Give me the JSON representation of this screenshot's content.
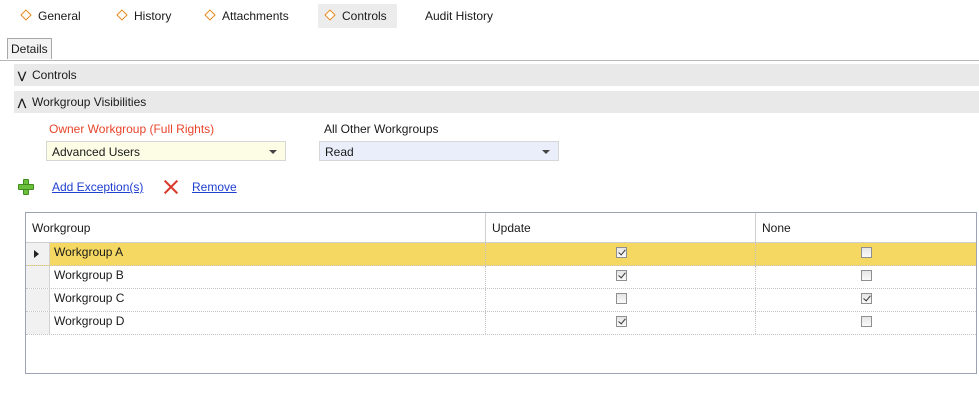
{
  "tabs": [
    {
      "label": "General",
      "icon": "diamond-icon"
    },
    {
      "label": "History",
      "icon": "diamond-icon"
    },
    {
      "label": "Attachments",
      "icon": "diamond-icon"
    },
    {
      "label": "Controls",
      "icon": "diamond-icon",
      "active": true
    },
    {
      "label": "Audit History"
    }
  ],
  "subtab": {
    "label": "Details"
  },
  "sections": {
    "controls": {
      "label": "Controls",
      "state": "collapsed"
    },
    "workgroup_visibilities": {
      "label": "Workgroup Visibilities",
      "state": "expanded"
    }
  },
  "owner": {
    "label": "Owner Workgroup (Full Rights)",
    "value": "Advanced Users"
  },
  "other": {
    "label": "All Other Workgroups",
    "value": "Read"
  },
  "actions": {
    "add_label": "Add Exception(s)",
    "remove_label": "Remove"
  },
  "grid": {
    "columns": [
      "Workgroup",
      "Update",
      "None"
    ],
    "rows": [
      {
        "name": "Workgroup A",
        "update": true,
        "none": false,
        "selected": true
      },
      {
        "name": "Workgroup B",
        "update": true,
        "none": false
      },
      {
        "name": "Workgroup C",
        "update": false,
        "none": true
      },
      {
        "name": "Workgroup D",
        "update": true,
        "none": false
      }
    ]
  },
  "colors": {
    "accent_diamond": "#e8891a",
    "owner_label": "#e8452a",
    "link": "#1f3fd1",
    "selected_row": "#f5d862"
  }
}
